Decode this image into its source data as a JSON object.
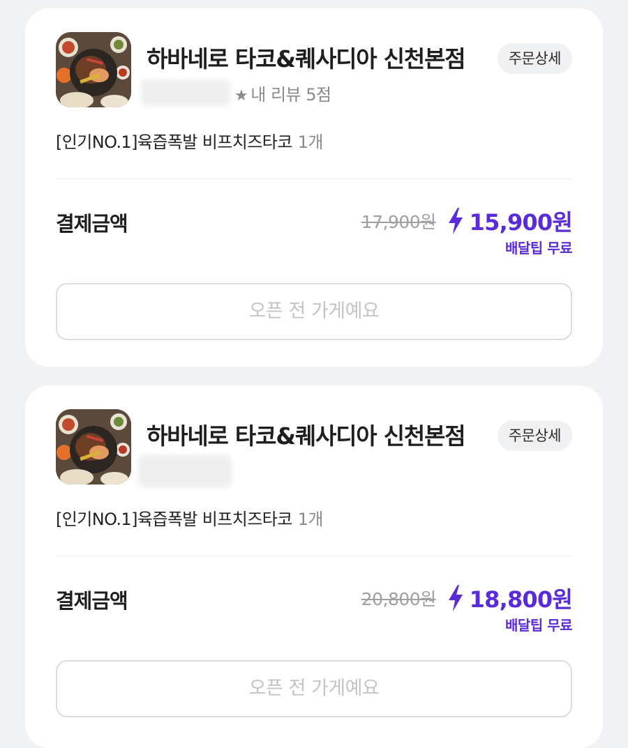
{
  "orders": [
    {
      "store_name": "하바네로 타코&퀘사디아 신천본점",
      "detail_label": "주문상세",
      "review_text": "내 리뷰 5점",
      "menu_item": "[인기NO.1]육즙폭발 비프치즈타코",
      "menu_qty": "1개",
      "pay_label": "결제금액",
      "original_price": "17,900원",
      "final_price": "15,900원",
      "delivery_tip": "배달팁 무료",
      "closed_label": "오픈 전 가게예요"
    },
    {
      "store_name": "하바네로 타코&퀘사디아 신천본점",
      "detail_label": "주문상세",
      "menu_item": "[인기NO.1]육즙폭발 비프치즈타코",
      "menu_qty": "1개",
      "pay_label": "결제금액",
      "original_price": "20,800원",
      "final_price": "18,800원",
      "delivery_tip": "배달팁 무료",
      "closed_label": "오픈 전 가게예요"
    }
  ],
  "colors": {
    "accent": "#5a2bd8",
    "background": "#f1f2f4",
    "card": "#ffffff",
    "muted": "#a0a0a0"
  },
  "icons": [
    "food-thumbnail",
    "star-icon",
    "lightning-icon"
  ]
}
